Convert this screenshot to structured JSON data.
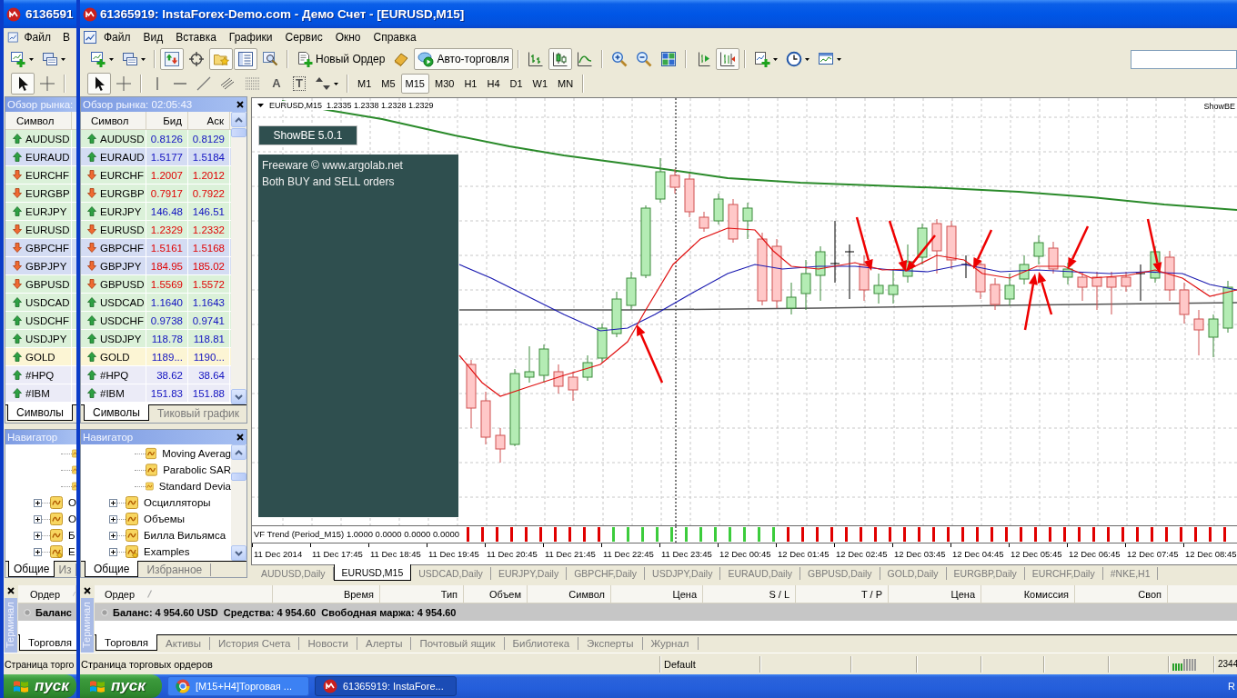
{
  "back_window": {
    "title": "6136591",
    "menu": [
      "Файл",
      "В"
    ],
    "toolbar": [
      {
        "kind": "new-chart",
        "dropdown": true,
        "pressed": false
      },
      {
        "kind": "profiles",
        "dropdown": true,
        "pressed": false
      }
    ],
    "drawing_tools": [
      {
        "kind": "cursor",
        "dropdown": false,
        "pressed": true
      },
      {
        "kind": "crosshair",
        "dropdown": false,
        "pressed": false
      }
    ],
    "market_watch": {
      "title": "Обзор рынка:",
      "columns": [
        "Символ"
      ],
      "rows": [
        {
          "symbol": "AUDUSD",
          "rising": true,
          "color": "#dbf1d9"
        },
        {
          "symbol": "EURAUD",
          "rising": true,
          "color": "#d4dcf3"
        },
        {
          "symbol": "EURCHF",
          "rising": false,
          "color": "#dbf1d9"
        },
        {
          "symbol": "EURGBP",
          "rising": false,
          "color": "#dbf1d9"
        },
        {
          "symbol": "EURJPY",
          "rising": true,
          "color": "#dbf1d9"
        },
        {
          "symbol": "EURUSD",
          "rising": false,
          "color": "#dbf1d9"
        },
        {
          "symbol": "GBPCHF",
          "rising": false,
          "color": "#d4dcf3"
        },
        {
          "symbol": "GBPJPY",
          "rising": false,
          "color": "#d4dcf3"
        },
        {
          "symbol": "GBPUSD",
          "rising": false,
          "color": "#dbf1d9"
        },
        {
          "symbol": "USDCAD",
          "rising": true,
          "color": "#dbf1d9"
        },
        {
          "symbol": "USDCHF",
          "rising": true,
          "color": "#dbf1d9"
        },
        {
          "symbol": "USDJPY",
          "rising": true,
          "color": "#dbf1d9"
        },
        {
          "symbol": "GOLD",
          "rising": true,
          "color": "#fcf5d4"
        },
        {
          "symbol": "#HPQ",
          "rising": true,
          "color": "#ebebf7"
        },
        {
          "symbol": "#IBM",
          "rising": true,
          "color": "#ebebf7"
        }
      ],
      "tabs": [
        {
          "label": "Символы",
          "selected": true
        }
      ]
    },
    "navigator": {
      "title": "Навигатор",
      "tree": [
        {
          "children": [
            {
              "kind": "indicator"
            },
            {
              "kind": "indicator"
            },
            {
              "kind": "indicator"
            }
          ]
        },
        {
          "label": "О",
          "kind": "group",
          "expanded": false
        },
        {
          "label": "О",
          "kind": "group",
          "expanded": false
        },
        {
          "label": "Б",
          "kind": "group",
          "expanded": false
        },
        {
          "label": "E",
          "kind": "custom-group",
          "expanded": false
        }
      ],
      "tabs": [
        {
          "label": "Общие",
          "selected": true
        },
        {
          "label": "Из",
          "selected": false
        }
      ]
    },
    "terminal": {
      "side_label": "Терминал",
      "columns": [
        {
          "label": "Ордер",
          "sorted": true
        }
      ],
      "balance": "Баланс",
      "tabs": [
        {
          "label": "Торговля",
          "selected": true
        }
      ]
    },
    "status_bar": {
      "message": "Страница торго"
    },
    "taskbar": {
      "start": "пуск"
    }
  },
  "window": {
    "title": "61365919: InstaForex-Demo.com - Демо Счет - [EURUSD,M15]"
  },
  "menu": [
    "Файл",
    "Вид",
    "Вставка",
    "Графики",
    "Сервис",
    "Окно",
    "Справка"
  ],
  "toolbar": {
    "groups": [
      [
        {
          "kind": "new-chart",
          "dropdown": true,
          "pressed": false
        },
        {
          "kind": "profiles",
          "dropdown": true,
          "pressed": false
        }
      ],
      [
        {
          "kind": "market-watch",
          "dropdown": false,
          "pressed": true
        },
        {
          "kind": "data-window",
          "dropdown": false,
          "pressed": false
        },
        {
          "kind": "navigator",
          "dropdown": false,
          "pressed": true
        },
        {
          "kind": "terminal",
          "dropdown": false,
          "pressed": true
        },
        {
          "kind": "tester",
          "dropdown": false,
          "pressed": false
        }
      ],
      [
        {
          "kind": "new-order",
          "label": "Новый Ордер",
          "dropdown": false,
          "pressed": false
        },
        {
          "kind": "meta-editor",
          "dropdown": false,
          "pressed": false
        },
        {
          "kind": "auto-trading",
          "label": "Авто-торговля",
          "dropdown": false,
          "pressed": true
        }
      ],
      [
        {
          "kind": "bar-chart",
          "dropdown": false,
          "pressed": false
        },
        {
          "kind": "candle-chart",
          "dropdown": false,
          "pressed": true
        },
        {
          "kind": "line-chart",
          "dropdown": false,
          "pressed": false
        }
      ],
      [
        {
          "kind": "zoom-in",
          "dropdown": false,
          "pressed": false
        },
        {
          "kind": "zoom-out",
          "dropdown": false,
          "pressed": false
        },
        {
          "kind": "tile",
          "dropdown": false,
          "pressed": false
        }
      ],
      [
        {
          "kind": "autoscroll",
          "dropdown": false,
          "pressed": false
        },
        {
          "kind": "chart-shift",
          "dropdown": false,
          "pressed": true
        }
      ],
      [
        {
          "kind": "indicators",
          "dropdown": true,
          "pressed": false
        },
        {
          "kind": "periods",
          "dropdown": true,
          "pressed": false
        },
        {
          "kind": "templates",
          "dropdown": true,
          "pressed": false
        }
      ]
    ]
  },
  "drawing_toolbar": {
    "groups": [
      [
        {
          "kind": "cursor",
          "dropdown": false,
          "pressed": true
        },
        {
          "kind": "crosshair",
          "dropdown": false,
          "pressed": false
        }
      ],
      [
        {
          "kind": "vline",
          "dropdown": false,
          "pressed": false
        },
        {
          "kind": "hline",
          "dropdown": false,
          "pressed": false
        },
        {
          "kind": "trendline",
          "dropdown": false,
          "pressed": false
        },
        {
          "kind": "channel",
          "dropdown": false,
          "pressed": false
        },
        {
          "kind": "fibo",
          "dropdown": false,
          "pressed": false
        },
        {
          "kind": "text",
          "glyph": "A",
          "dropdown": false,
          "pressed": false
        },
        {
          "kind": "label",
          "glyph": "T",
          "dropdown": false,
          "pressed": false
        },
        {
          "kind": "arrows",
          "dropdown": true,
          "pressed": false
        }
      ]
    ],
    "periods": [
      {
        "label": "M1",
        "selected": false
      },
      {
        "label": "M5",
        "selected": false
      },
      {
        "label": "M15",
        "selected": true
      },
      {
        "label": "M30",
        "selected": false
      },
      {
        "label": "H1",
        "selected": false
      },
      {
        "label": "H4",
        "selected": false
      },
      {
        "label": "D1",
        "selected": false
      },
      {
        "label": "W1",
        "selected": false
      },
      {
        "label": "MN",
        "selected": false
      }
    ]
  },
  "market_watch": {
    "title": "Обзор рынка: 02:05:43",
    "columns": [
      "Символ",
      "Бид",
      "Аск"
    ],
    "rows": [
      {
        "symbol": "AUDUSD",
        "bid": "0.8126",
        "ask": "0.8129",
        "rising": true,
        "color": "#dbf1d9"
      },
      {
        "symbol": "EURAUD",
        "bid": "1.5177",
        "ask": "1.5184",
        "rising": true,
        "color": "#d4dcf3"
      },
      {
        "symbol": "EURCHF",
        "bid": "1.2007",
        "ask": "1.2012",
        "rising": false,
        "color": "#dbf1d9"
      },
      {
        "symbol": "EURGBP",
        "bid": "0.7917",
        "ask": "0.7922",
        "rising": false,
        "color": "#dbf1d9"
      },
      {
        "symbol": "EURJPY",
        "bid": "146.48",
        "ask": "146.51",
        "rising": true,
        "color": "#dbf1d9"
      },
      {
        "symbol": "EURUSD",
        "bid": "1.2329",
        "ask": "1.2332",
        "rising": false,
        "color": "#dbf1d9"
      },
      {
        "symbol": "GBPCHF",
        "bid": "1.5161",
        "ask": "1.5168",
        "rising": false,
        "color": "#d4dcf3"
      },
      {
        "symbol": "GBPJPY",
        "bid": "184.95",
        "ask": "185.02",
        "rising": false,
        "color": "#d4dcf3"
      },
      {
        "symbol": "GBPUSD",
        "bid": "1.5569",
        "ask": "1.5572",
        "rising": false,
        "color": "#dbf1d9"
      },
      {
        "symbol": "USDCAD",
        "bid": "1.1640",
        "ask": "1.1643",
        "rising": true,
        "color": "#dbf1d9"
      },
      {
        "symbol": "USDCHF",
        "bid": "0.9738",
        "ask": "0.9741",
        "rising": true,
        "color": "#dbf1d9"
      },
      {
        "symbol": "USDJPY",
        "bid": "118.78",
        "ask": "118.81",
        "rising": true,
        "color": "#dbf1d9"
      },
      {
        "symbol": "GOLD",
        "bid": "1189...",
        "ask": "1190...",
        "rising": true,
        "color": "#fcf5d4"
      },
      {
        "symbol": "#HPQ",
        "bid": "38.62",
        "ask": "38.64",
        "rising": true,
        "color": "#ebebf7"
      },
      {
        "symbol": "#IBM",
        "bid": "151.83",
        "ask": "151.88",
        "rising": true,
        "color": "#ebebf7"
      }
    ],
    "tabs": [
      {
        "label": "Символы",
        "selected": true
      },
      {
        "label": "Тиковый график",
        "selected": false
      }
    ]
  },
  "navigator": {
    "title": "Навигатор",
    "tree": [
      {
        "children": [
          {
            "label": "Moving Averag",
            "kind": "indicator"
          },
          {
            "label": "Parabolic SAR",
            "kind": "indicator"
          },
          {
            "label": "Standard Devia",
            "kind": "indicator"
          }
        ]
      },
      {
        "label": "Осцилляторы",
        "kind": "group",
        "expanded": false
      },
      {
        "label": "Объемы",
        "kind": "group",
        "expanded": false
      },
      {
        "label": "Билла Вильямса",
        "kind": "group",
        "expanded": false
      },
      {
        "label": "Examples",
        "kind": "custom-group",
        "expanded": false
      }
    ],
    "tabs": [
      {
        "label": "Общие",
        "selected": true
      },
      {
        "label": "Избранное",
        "selected": false
      }
    ]
  },
  "chart": {
    "header": "EURUSD,M15  1.2335 1.2338 1.2328 1.2329",
    "expert": "ShowBE",
    "panel": {
      "button": "ShowBE 5.0.1",
      "lines": [
        "Freeware © www.argolab.net",
        "Both BUY and SELL orders"
      ]
    },
    "indicator": "VF Trend (Period_M15) 1.0000 0.0000 0.0000 0.0000",
    "time_labels": [
      "11 Dec 2014",
      "11 Dec 17:45",
      "11 Dec 18:45",
      "11 Dec 19:45",
      "11 Dec 20:45",
      "11 Dec 21:45",
      "11 Dec 22:45",
      "11 Dec 23:45",
      "12 Dec 00:45",
      "12 Dec 01:45",
      "12 Dec 02:45",
      "12 Dec 03:45",
      "12 Dec 04:45",
      "12 Dec 05:45",
      "12 Dec 06:45",
      "12 Dec 07:45",
      "12 Dec 08:45"
    ]
  },
  "chart_tabs": [
    {
      "label": "AUDUSD,Daily",
      "selected": false
    },
    {
      "label": "EURUSD,M15",
      "selected": true
    },
    {
      "label": "USDCAD,Daily",
      "selected": false
    },
    {
      "label": "EURJPY,Daily",
      "selected": false
    },
    {
      "label": "GBPCHF,Daily",
      "selected": false
    },
    {
      "label": "USDJPY,Daily",
      "selected": false
    },
    {
      "label": "EURAUD,Daily",
      "selected": false
    },
    {
      "label": "GBPUSD,Daily",
      "selected": false
    },
    {
      "label": "GOLD,Daily",
      "selected": false
    },
    {
      "label": "EURGBP,Daily",
      "selected": false
    },
    {
      "label": "EURCHF,Daily",
      "selected": false
    },
    {
      "label": "#NKE,H1",
      "selected": false
    }
  ],
  "terminal": {
    "side_label": "Терминал",
    "columns": [
      {
        "label": "Ордер",
        "sorted": true
      },
      {
        "label": "Время",
        "sorted": false
      },
      {
        "label": "Тип",
        "sorted": false
      },
      {
        "label": "Объем",
        "sorted": false
      },
      {
        "label": "Символ",
        "sorted": false
      },
      {
        "label": "Цена",
        "sorted": false
      },
      {
        "label": "S / L",
        "sorted": false
      },
      {
        "label": "T / P",
        "sorted": false
      },
      {
        "label": "Цена",
        "sorted": false
      },
      {
        "label": "Комиссия",
        "sorted": false
      },
      {
        "label": "Своп",
        "sorted": false
      }
    ],
    "balance": "Баланс: 4 954.60 USD  Средства: 4 954.60  Свободная маржа: 4 954.60",
    "tabs": [
      {
        "label": "Торговля",
        "selected": true
      },
      {
        "label": "Активы",
        "selected": false
      },
      {
        "label": "История Счета",
        "selected": false
      },
      {
        "label": "Новости",
        "selected": false
      },
      {
        "label": "Алерты",
        "selected": false
      },
      {
        "label": "Почтовый ящик",
        "selected": false
      },
      {
        "label": "Библиотека",
        "selected": false
      },
      {
        "label": "Эксперты",
        "selected": false
      },
      {
        "label": "Журнал",
        "selected": false
      }
    ]
  },
  "status_bar": {
    "message": "Страница торговых ордеров",
    "profile": "Default",
    "traffic": "2344"
  },
  "taskbar": {
    "start": "пуск",
    "tasks": [
      {
        "label": "[M15+H4]Торговая ...",
        "kind": "browser",
        "selected": false
      },
      {
        "label": "61365919: InstaFore...",
        "kind": "terminal",
        "selected": true
      }
    ],
    "tray": "R"
  }
}
